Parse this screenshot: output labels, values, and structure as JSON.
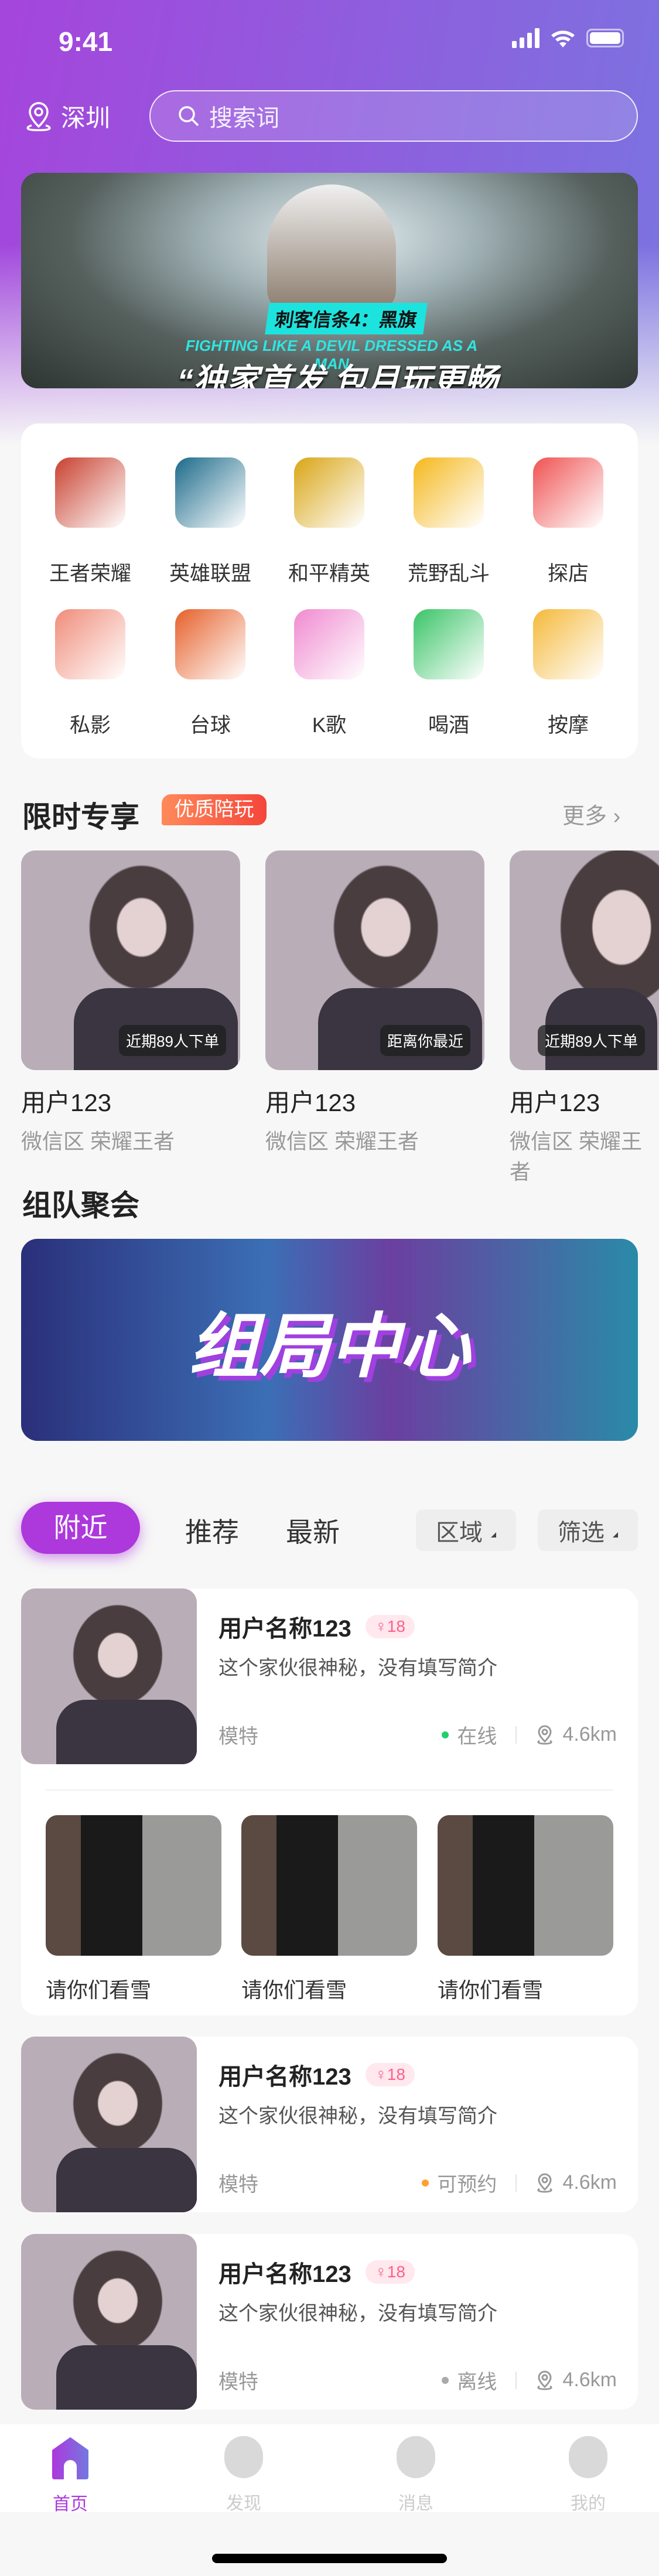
{
  "status": {
    "time": "9:41"
  },
  "header": {
    "city": "深圳",
    "search_placeholder": "搜索词"
  },
  "banner": {
    "game_title": "刺客信条4：黑旗",
    "subtitle": "FIGHTING LIKE A DEVIL DRESSED AS A MAN",
    "slogan": "“独家首发 包月玩更畅爽”"
  },
  "categories": [
    {
      "label": "王者荣耀",
      "color": "#c8402f"
    },
    {
      "label": "英雄联盟",
      "color": "#1b6a8a"
    },
    {
      "label": "和平精英",
      "color": "#d9a514"
    },
    {
      "label": "荒野乱斗",
      "color": "#f5b81c"
    },
    {
      "label": "探店",
      "color": "#f05252"
    },
    {
      "label": "私影",
      "color": "#f08c7a"
    },
    {
      "label": "台球",
      "color": "#e6602a"
    },
    {
      "label": "K歌",
      "color": "#f08ad0"
    },
    {
      "label": "喝酒",
      "color": "#3ac467"
    },
    {
      "label": "按摩",
      "color": "#f5b93a"
    }
  ],
  "limited": {
    "title": "限时专享",
    "tag": "优质陪玩",
    "more": "更多",
    "cards": [
      {
        "badge": "近期89人下单",
        "name": "用户123",
        "sub": "微信区 荣耀王者"
      },
      {
        "badge": "距离你最近",
        "name": "用户123",
        "sub": "微信区 荣耀王者"
      },
      {
        "badge": "近期89人下单",
        "name": "用户123",
        "sub": "微信区 荣耀王者"
      }
    ]
  },
  "team": {
    "title": "组队聚会",
    "banner_text": "组局中心"
  },
  "feed_tabs": {
    "active": "附近",
    "tabs": [
      "推荐",
      "最新"
    ],
    "filters": [
      "区域",
      "筛选"
    ]
  },
  "users": [
    {
      "name": "用户名称123",
      "age": "18",
      "intro": "这个家伙很神秘，没有填写简介",
      "job": "模特",
      "status": "在线",
      "status_color": "#1fd16b",
      "distance": "4.6km",
      "posts": [
        {
          "caption": "请你们看雪"
        },
        {
          "caption": "请你们看雪"
        },
        {
          "caption": "请你们看雪"
        }
      ]
    },
    {
      "name": "用户名称123",
      "age": "18",
      "intro": "这个家伙很神秘，没有填写简介",
      "job": "模特",
      "status": "可预约",
      "status_color": "#ffa02e",
      "distance": "4.6km"
    },
    {
      "name": "用户名称123",
      "age": "18",
      "intro": "这个家伙很神秘，没有填写简介",
      "job": "模特",
      "status": "离线",
      "status_color": "#aaaaaa",
      "distance": "4.6km"
    }
  ],
  "tabbar": [
    {
      "label": "首页",
      "active": true
    },
    {
      "label": "发现"
    },
    {
      "label": "消息"
    },
    {
      "label": "我的"
    }
  ],
  "colors": {
    "accent": "#ad38dc",
    "tag": "#f5453a"
  }
}
